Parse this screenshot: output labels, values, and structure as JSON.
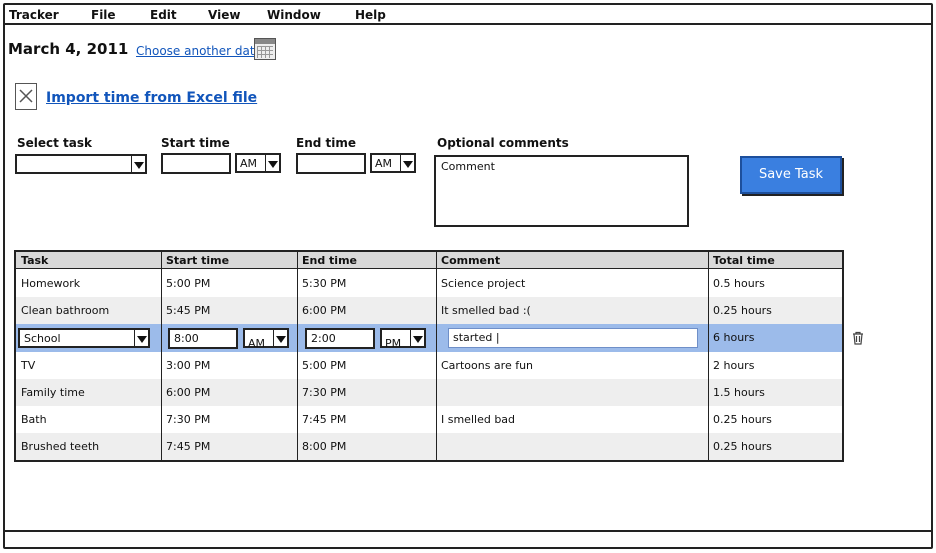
{
  "menu": [
    "Tracker",
    "File",
    "Edit",
    "View",
    "Window",
    "Help"
  ],
  "header": {
    "date": "March 4, 2011",
    "choose_date_link": "Choose another date",
    "import_link": "Import time from Excel file"
  },
  "form": {
    "select_task_label": "Select task",
    "start_time_label": "Start time",
    "end_time_label": "End time",
    "comments_label": "Optional comments",
    "start_ampm": "AM",
    "end_ampm": "AM",
    "comment_value": "Comment",
    "save_button": "Save Task"
  },
  "table": {
    "columns": [
      "Task",
      "Start time",
      "End time",
      "Comment",
      "Total time"
    ],
    "rows": [
      {
        "task": "Homework",
        "start": "5:00 PM",
        "end": "5:30 PM",
        "comment": "Science project",
        "total": "0.5 hours"
      },
      {
        "task": "Clean bathroom",
        "start": "5:45 PM",
        "end": "6:00 PM",
        "comment": "It smelled bad :(",
        "total": "0.25 hours"
      },
      {
        "task": "School",
        "start": "8:00",
        "start_ampm": "AM",
        "end": "2:00",
        "end_ampm": "PM",
        "comment": "started |",
        "total": "6 hours"
      },
      {
        "task": "TV",
        "start": "3:00 PM",
        "end": "5:00 PM",
        "comment": "Cartoons are fun",
        "total": "2 hours"
      },
      {
        "task": "Family time",
        "start": "6:00 PM",
        "end": "7:30 PM",
        "comment": "",
        "total": "1.5 hours"
      },
      {
        "task": "Bath",
        "start": "7:30 PM",
        "end": "7:45 PM",
        "comment": "I smelled bad",
        "total": "0.25 hours"
      },
      {
        "task": "Brushed teeth",
        "start": "7:45 PM",
        "end": "8:00 PM",
        "comment": "",
        "total": "0.25 hours"
      }
    ]
  },
  "colors": {
    "accent": "#3a7fe0",
    "link": "#1155bb",
    "selected_row": "#9cbbea",
    "header_bg": "#d9d9d9"
  }
}
